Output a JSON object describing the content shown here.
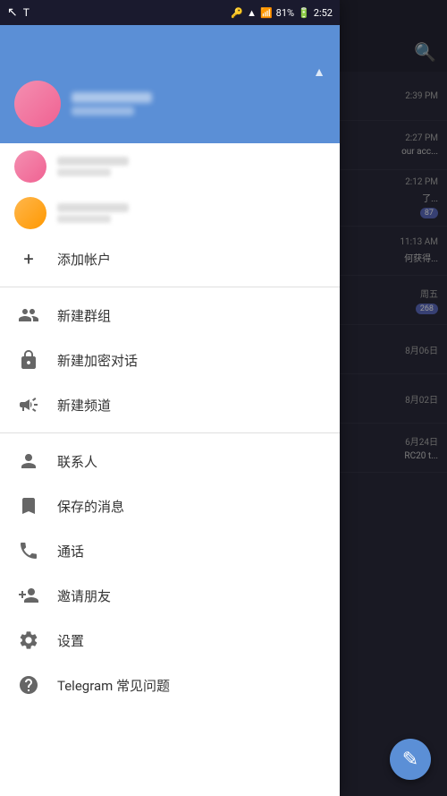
{
  "statusBar": {
    "battery": "81%",
    "time": "2:52",
    "icons": [
      "cursor",
      "T",
      "key",
      "wifi",
      "signal"
    ]
  },
  "drawer": {
    "chevronUp": "▲",
    "addAccount": {
      "icon": "+",
      "label": "添加帐户"
    },
    "menuItems": [
      {
        "id": "new-group",
        "icon": "group",
        "label": "新建群组"
      },
      {
        "id": "new-secret",
        "icon": "lock",
        "label": "新建加密对话"
      },
      {
        "id": "new-channel",
        "icon": "megaphone",
        "label": "新建频道"
      },
      {
        "id": "contacts",
        "icon": "person",
        "label": "联系人"
      },
      {
        "id": "saved",
        "icon": "bookmark",
        "label": "保存的消息"
      },
      {
        "id": "calls",
        "icon": "phone",
        "label": "通话"
      },
      {
        "id": "invite",
        "icon": "person-add",
        "label": "邀请朋友"
      },
      {
        "id": "settings",
        "icon": "settings",
        "label": "设置"
      },
      {
        "id": "faq",
        "icon": "help",
        "label": "Telegram 常见问题"
      }
    ]
  },
  "chatList": {
    "items": [
      {
        "time": "2:39 PM",
        "preview": "",
        "badge": ""
      },
      {
        "time": "2:27 PM",
        "preview": "our acc...",
        "badge": ""
      },
      {
        "time": "2:12 PM",
        "preview": "了...",
        "badge": "87"
      },
      {
        "time": "11:13 AM",
        "preview": "何获得...",
        "badge": ""
      },
      {
        "time": "周五",
        "preview": "",
        "badge": "268"
      },
      {
        "time": "8月06日",
        "preview": "",
        "badge": ""
      },
      {
        "time": "8月02日",
        "preview": "",
        "badge": ""
      },
      {
        "time": "6月24日",
        "preview": "RC20 t...",
        "badge": ""
      }
    ]
  },
  "fab": {
    "icon": "✎"
  }
}
